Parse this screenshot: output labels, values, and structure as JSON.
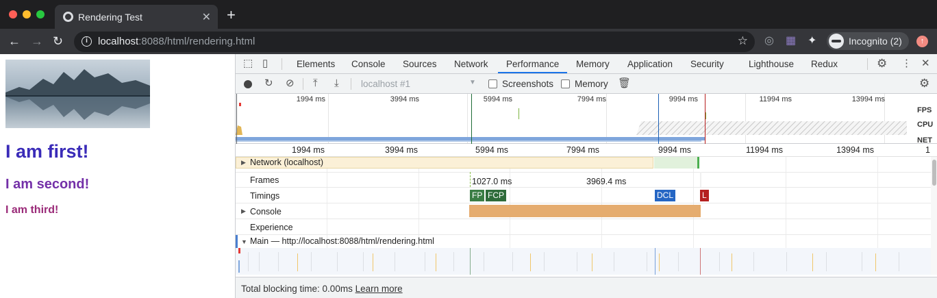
{
  "browser": {
    "tab_title": "Rendering Test",
    "url_host": "localhost",
    "url_rest": ":8088/html/rendering.html",
    "profile_label": "Incognito (2)"
  },
  "page": {
    "heading1": "I am first!",
    "heading2": "I am second!",
    "heading3": "I am third!"
  },
  "devtools": {
    "tabs": [
      "Elements",
      "Console",
      "Sources",
      "Network",
      "Performance",
      "Memory",
      "Application",
      "Security",
      "Lighthouse",
      "Redux"
    ],
    "active_tab": "Performance",
    "target_select": "localhost #1",
    "screenshots_label": "Screenshots",
    "memory_label": "Memory",
    "overview_ticks": [
      "1994 ms",
      "3994 ms",
      "5994 ms",
      "7994 ms",
      "9994 ms",
      "11994 ms",
      "13994 ms"
    ],
    "overview_lanes": [
      "FPS",
      "CPU",
      "NET"
    ],
    "ruler_ticks": [
      "1994 ms",
      "3994 ms",
      "5994 ms",
      "7994 ms",
      "9994 ms",
      "11994 ms",
      "13994 ms",
      "1"
    ],
    "tracks": {
      "network": "Network (localhost)",
      "frames": "Frames",
      "frame1": "1027.0 ms",
      "frame2": "3969.4 ms",
      "timings": "Timings",
      "fp": "FP",
      "fcp": "FCP",
      "dcl": "DCL",
      "l": "L",
      "console": "Console",
      "experience": "Experience",
      "main": "Main — http://localhost:8088/html/rendering.html"
    },
    "status_text": "Total blocking time: 0.00ms",
    "learn_more": "Learn more"
  }
}
